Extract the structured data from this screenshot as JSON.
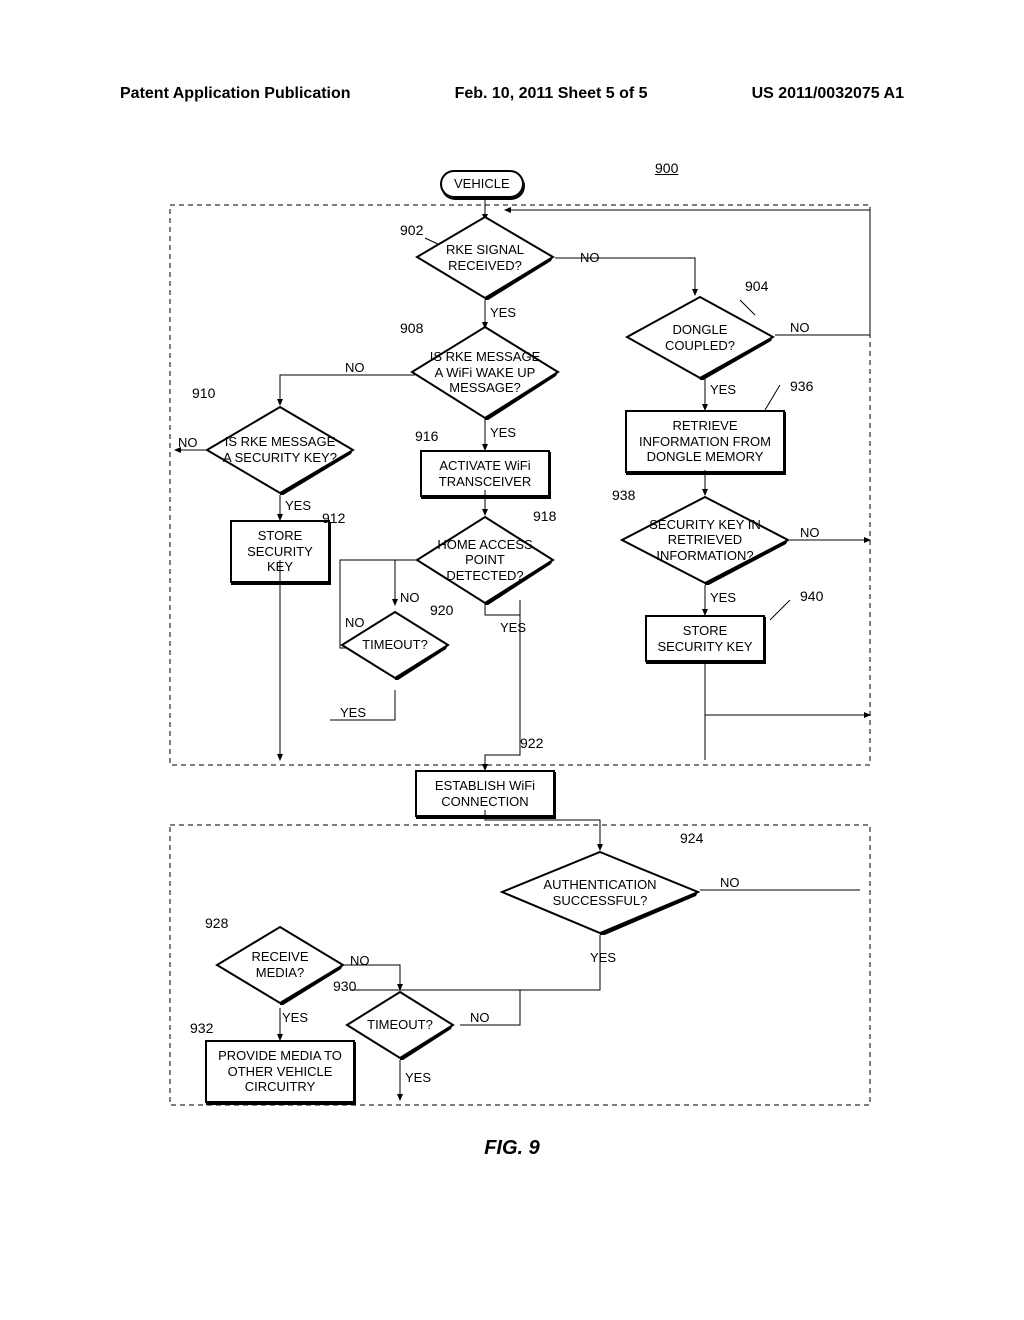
{
  "header": {
    "left": "Patent Application Publication",
    "center": "Feb. 10, 2011  Sheet 5 of 5",
    "right": "US 2011/0032075 A1"
  },
  "figure_label": "FIG. 9",
  "ref": {
    "r900": "900",
    "r902": "902",
    "r904": "904",
    "r908": "908",
    "r910": "910",
    "r912": "912",
    "r916": "916",
    "r918": "918",
    "r920": "920",
    "r922": "922",
    "r924": "924",
    "r928": "928",
    "r930": "930",
    "r932": "932",
    "r936": "936",
    "r938": "938",
    "r940": "940"
  },
  "nodes": {
    "start": "VEHICLE",
    "d902": "RKE SIGNAL RECEIVED?",
    "d904": "DONGLE COUPLED?",
    "d908": "IS RKE MESSAGE A WiFi WAKE UP MESSAGE?",
    "d910": "IS RKE MESSAGE A SECURITY KEY?",
    "p912": "STORE SECURITY KEY",
    "p916": "ACTIVATE WiFi TRANSCEIVER",
    "d918": "HOME ACCESS POINT DETECTED?",
    "d920": "TIMEOUT?",
    "p922": "ESTABLISH WiFi CONNECTION",
    "d924": "AUTHENTICATION SUCCESSFUL?",
    "d928": "RECEIVE MEDIA?",
    "d930": "TIMEOUT?",
    "p932": "PROVIDE MEDIA TO OTHER VEHICLE CIRCUITRY",
    "p936": "RETRIEVE INFORMATION FROM DONGLE MEMORY",
    "d938": "SECURITY KEY IN RETRIEVED INFORMATION?",
    "p940": "STORE SECURITY KEY"
  },
  "labels": {
    "yes": "YES",
    "no": "NO"
  }
}
